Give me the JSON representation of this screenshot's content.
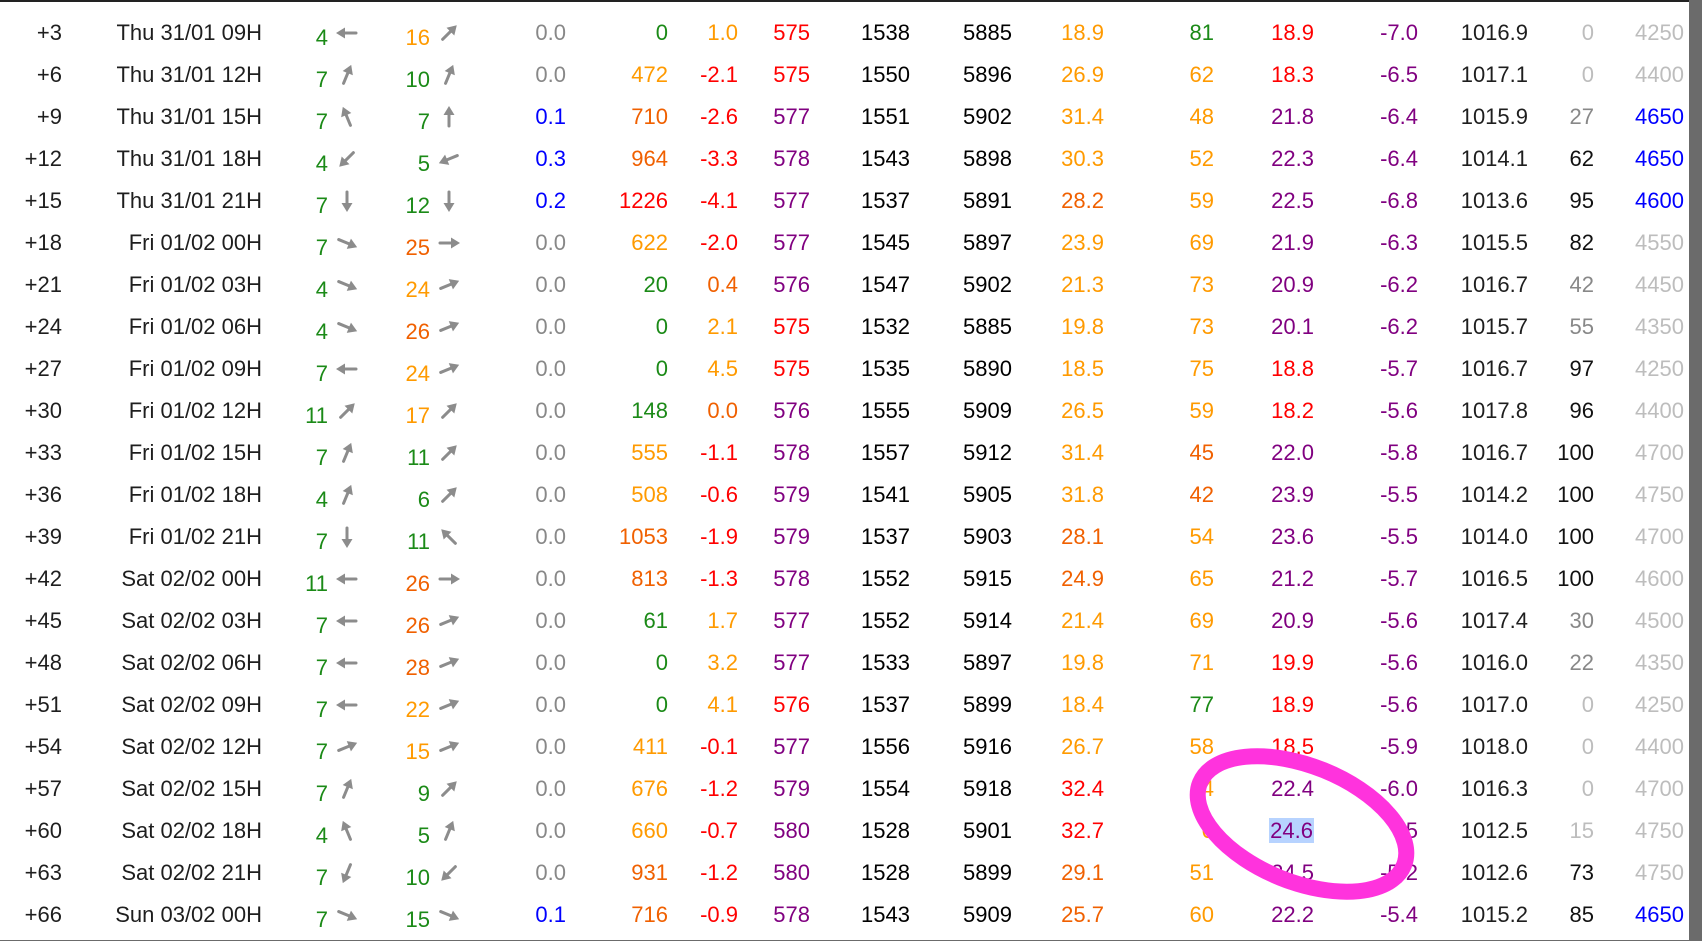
{
  "colors": {
    "green": "#1b8a17",
    "orange": "#ff9a00",
    "dark_orange": "#f06000",
    "red": "#ff0000",
    "purple": "#800080",
    "blue": "#0000ff",
    "gray": "#888888",
    "light_gray": "#bdbdbd",
    "black": "#111111",
    "arrow_gray": "#8c8c8c",
    "marker_magenta": "#ff33dd",
    "selection_blue": "#b7d3ff"
  },
  "annotation": {
    "shape": "ellipse",
    "color": "#ff33dd",
    "highlighted_value": "24.6"
  },
  "rows": [
    {
      "step": "+3",
      "date": "Thu 31/01 09H",
      "w1": "4",
      "w1c": "green",
      "a1": "W",
      "w2": "16",
      "w2c": "orange",
      "a2": "NE",
      "rain": "0.0",
      "rainc": "gray",
      "rad": "0",
      "radc": "green",
      "li": "1.0",
      "lic": "orange",
      "t500": "575",
      "t500c": "red",
      "z850": "1538",
      "z500": "5885",
      "temp": "18.9",
      "tempc": "orange",
      "rh": "81",
      "rhc": "green",
      "dew": "18.9",
      "dewc": "red",
      "t850": "-7.0",
      "t850c": "purple",
      "pres": "1016.9",
      "cloud": "0",
      "cloudc": "light_gray",
      "frz": "4250",
      "frzc": "light_gray"
    },
    {
      "step": "+6",
      "date": "Thu 31/01 12H",
      "w1": "7",
      "w1c": "green",
      "a1": "NNE",
      "w2": "10",
      "w2c": "green",
      "a2": "NNE",
      "rain": "0.0",
      "rainc": "gray",
      "rad": "472",
      "radc": "orange",
      "li": "-2.1",
      "lic": "red",
      "t500": "575",
      "t500c": "red",
      "z850": "1550",
      "z500": "5896",
      "temp": "26.9",
      "tempc": "orange",
      "rh": "62",
      "rhc": "orange",
      "dew": "18.3",
      "dewc": "red",
      "t850": "-6.5",
      "t850c": "purple",
      "pres": "1017.1",
      "cloud": "0",
      "cloudc": "light_gray",
      "frz": "4400",
      "frzc": "light_gray"
    },
    {
      "step": "+9",
      "date": "Thu 31/01 15H",
      "w1": "7",
      "w1c": "green",
      "a1": "NNW",
      "w2": "7",
      "w2c": "green",
      "a2": "N",
      "rain": "0.1",
      "rainc": "blue",
      "rad": "710",
      "radc": "dark_orange",
      "li": "-2.6",
      "lic": "red",
      "t500": "577",
      "t500c": "purple",
      "z850": "1551",
      "z500": "5902",
      "temp": "31.4",
      "tempc": "orange",
      "rh": "48",
      "rhc": "orange",
      "dew": "21.8",
      "dewc": "purple",
      "t850": "-6.4",
      "t850c": "purple",
      "pres": "1015.9",
      "cloud": "27",
      "cloudc": "gray",
      "frz": "4650",
      "frzc": "blue"
    },
    {
      "step": "+12",
      "date": "Thu 31/01 18H",
      "w1": "4",
      "w1c": "green",
      "a1": "SW",
      "w2": "5",
      "w2c": "green",
      "a2": "WSW",
      "rain": "0.3",
      "rainc": "blue",
      "rad": "964",
      "radc": "dark_orange",
      "li": "-3.3",
      "lic": "red",
      "t500": "578",
      "t500c": "purple",
      "z850": "1543",
      "z500": "5898",
      "temp": "30.3",
      "tempc": "orange",
      "rh": "52",
      "rhc": "orange",
      "dew": "22.3",
      "dewc": "purple",
      "t850": "-6.4",
      "t850c": "purple",
      "pres": "1014.1",
      "cloud": "62",
      "cloudc": "black",
      "frz": "4650",
      "frzc": "blue"
    },
    {
      "step": "+15",
      "date": "Thu 31/01 21H",
      "w1": "7",
      "w1c": "green",
      "a1": "S",
      "w2": "12",
      "w2c": "green",
      "a2": "S",
      "rain": "0.2",
      "rainc": "blue",
      "rad": "1226",
      "radc": "red",
      "li": "-4.1",
      "lic": "red",
      "t500": "577",
      "t500c": "purple",
      "z850": "1537",
      "z500": "5891",
      "temp": "28.2",
      "tempc": "dark_orange",
      "rh": "59",
      "rhc": "orange",
      "dew": "22.5",
      "dewc": "purple",
      "t850": "-6.8",
      "t850c": "purple",
      "pres": "1013.6",
      "cloud": "95",
      "cloudc": "black",
      "frz": "4600",
      "frzc": "blue"
    },
    {
      "step": "+18",
      "date": "Fri 01/02 00H",
      "w1": "7",
      "w1c": "green",
      "a1": "ESE",
      "w2": "25",
      "w2c": "dark_orange",
      "a2": "E",
      "rain": "0.0",
      "rainc": "gray",
      "rad": "622",
      "radc": "orange",
      "li": "-2.0",
      "lic": "red",
      "t500": "577",
      "t500c": "purple",
      "z850": "1545",
      "z500": "5897",
      "temp": "23.9",
      "tempc": "orange",
      "rh": "69",
      "rhc": "orange",
      "dew": "21.9",
      "dewc": "purple",
      "t850": "-6.3",
      "t850c": "purple",
      "pres": "1015.5",
      "cloud": "82",
      "cloudc": "black",
      "frz": "4550",
      "frzc": "light_gray"
    },
    {
      "step": "+21",
      "date": "Fri 01/02 03H",
      "w1": "4",
      "w1c": "green",
      "a1": "ESE",
      "w2": "24",
      "w2c": "orange",
      "a2": "ENE",
      "rain": "0.0",
      "rainc": "gray",
      "rad": "20",
      "radc": "green",
      "li": "0.4",
      "lic": "dark_orange",
      "t500": "576",
      "t500c": "purple",
      "z850": "1547",
      "z500": "5902",
      "temp": "21.3",
      "tempc": "orange",
      "rh": "73",
      "rhc": "orange",
      "dew": "20.9",
      "dewc": "purple",
      "t850": "-6.2",
      "t850c": "purple",
      "pres": "1016.7",
      "cloud": "42",
      "cloudc": "gray",
      "frz": "4450",
      "frzc": "light_gray"
    },
    {
      "step": "+24",
      "date": "Fri 01/02 06H",
      "w1": "4",
      "w1c": "green",
      "a1": "ESE",
      "w2": "26",
      "w2c": "dark_orange",
      "a2": "ENE",
      "rain": "0.0",
      "rainc": "gray",
      "rad": "0",
      "radc": "green",
      "li": "2.1",
      "lic": "orange",
      "t500": "575",
      "t500c": "red",
      "z850": "1532",
      "z500": "5885",
      "temp": "19.8",
      "tempc": "orange",
      "rh": "73",
      "rhc": "orange",
      "dew": "20.1",
      "dewc": "purple",
      "t850": "-6.2",
      "t850c": "purple",
      "pres": "1015.7",
      "cloud": "55",
      "cloudc": "gray",
      "frz": "4350",
      "frzc": "light_gray"
    },
    {
      "step": "+27",
      "date": "Fri 01/02 09H",
      "w1": "7",
      "w1c": "green",
      "a1": "W",
      "w2": "24",
      "w2c": "orange",
      "a2": "ENE",
      "rain": "0.0",
      "rainc": "gray",
      "rad": "0",
      "radc": "green",
      "li": "4.5",
      "lic": "orange",
      "t500": "575",
      "t500c": "red",
      "z850": "1535",
      "z500": "5890",
      "temp": "18.5",
      "tempc": "orange",
      "rh": "75",
      "rhc": "orange",
      "dew": "18.8",
      "dewc": "red",
      "t850": "-5.7",
      "t850c": "purple",
      "pres": "1016.7",
      "cloud": "97",
      "cloudc": "black",
      "frz": "4250",
      "frzc": "light_gray"
    },
    {
      "step": "+30",
      "date": "Fri 01/02 12H",
      "w1": "11",
      "w1c": "green",
      "a1": "NE",
      "w2": "17",
      "w2c": "orange",
      "a2": "NE",
      "rain": "0.0",
      "rainc": "gray",
      "rad": "148",
      "radc": "green",
      "li": "0.0",
      "lic": "dark_orange",
      "t500": "576",
      "t500c": "purple",
      "z850": "1555",
      "z500": "5909",
      "temp": "26.5",
      "tempc": "orange",
      "rh": "59",
      "rhc": "orange",
      "dew": "18.2",
      "dewc": "red",
      "t850": "-5.6",
      "t850c": "purple",
      "pres": "1017.8",
      "cloud": "96",
      "cloudc": "black",
      "frz": "4400",
      "frzc": "light_gray"
    },
    {
      "step": "+33",
      "date": "Fri 01/02 15H",
      "w1": "7",
      "w1c": "green",
      "a1": "NNE",
      "w2": "11",
      "w2c": "green",
      "a2": "NE",
      "rain": "0.0",
      "rainc": "gray",
      "rad": "555",
      "radc": "orange",
      "li": "-1.1",
      "lic": "red",
      "t500": "578",
      "t500c": "purple",
      "z850": "1557",
      "z500": "5912",
      "temp": "31.4",
      "tempc": "orange",
      "rh": "45",
      "rhc": "dark_orange",
      "dew": "22.0",
      "dewc": "purple",
      "t850": "-5.8",
      "t850c": "purple",
      "pres": "1016.7",
      "cloud": "100",
      "cloudc": "black",
      "frz": "4700",
      "frzc": "light_gray"
    },
    {
      "step": "+36",
      "date": "Fri 01/02 18H",
      "w1": "4",
      "w1c": "green",
      "a1": "NNE",
      "w2": "6",
      "w2c": "green",
      "a2": "NE",
      "rain": "0.0",
      "rainc": "gray",
      "rad": "508",
      "radc": "orange",
      "li": "-0.6",
      "lic": "red",
      "t500": "579",
      "t500c": "purple",
      "z850": "1541",
      "z500": "5905",
      "temp": "31.8",
      "tempc": "orange",
      "rh": "42",
      "rhc": "dark_orange",
      "dew": "23.9",
      "dewc": "purple",
      "t850": "-5.5",
      "t850c": "purple",
      "pres": "1014.2",
      "cloud": "100",
      "cloudc": "black",
      "frz": "4750",
      "frzc": "light_gray"
    },
    {
      "step": "+39",
      "date": "Fri 01/02 21H",
      "w1": "7",
      "w1c": "green",
      "a1": "S",
      "w2": "11",
      "w2c": "green",
      "a2": "NW",
      "rain": "0.0",
      "rainc": "gray",
      "rad": "1053",
      "radc": "dark_orange",
      "li": "-1.9",
      "lic": "red",
      "t500": "579",
      "t500c": "purple",
      "z850": "1537",
      "z500": "5903",
      "temp": "28.1",
      "tempc": "dark_orange",
      "rh": "54",
      "rhc": "orange",
      "dew": "23.6",
      "dewc": "purple",
      "t850": "-5.5",
      "t850c": "purple",
      "pres": "1014.0",
      "cloud": "100",
      "cloudc": "black",
      "frz": "4700",
      "frzc": "light_gray"
    },
    {
      "step": "+42",
      "date": "Sat 02/02 00H",
      "w1": "11",
      "w1c": "green",
      "a1": "W",
      "w2": "26",
      "w2c": "dark_orange",
      "a2": "E",
      "rain": "0.0",
      "rainc": "gray",
      "rad": "813",
      "radc": "dark_orange",
      "li": "-1.3",
      "lic": "red",
      "t500": "578",
      "t500c": "purple",
      "z850": "1552",
      "z500": "5915",
      "temp": "24.9",
      "tempc": "dark_orange",
      "rh": "65",
      "rhc": "orange",
      "dew": "21.2",
      "dewc": "purple",
      "t850": "-5.7",
      "t850c": "purple",
      "pres": "1016.5",
      "cloud": "100",
      "cloudc": "black",
      "frz": "4600",
      "frzc": "light_gray"
    },
    {
      "step": "+45",
      "date": "Sat 02/02 03H",
      "w1": "7",
      "w1c": "green",
      "a1": "W",
      "w2": "26",
      "w2c": "dark_orange",
      "a2": "ENE",
      "rain": "0.0",
      "rainc": "gray",
      "rad": "61",
      "radc": "green",
      "li": "1.7",
      "lic": "orange",
      "t500": "577",
      "t500c": "purple",
      "z850": "1552",
      "z500": "5914",
      "temp": "21.4",
      "tempc": "orange",
      "rh": "69",
      "rhc": "orange",
      "dew": "20.9",
      "dewc": "purple",
      "t850": "-5.6",
      "t850c": "purple",
      "pres": "1017.4",
      "cloud": "30",
      "cloudc": "gray",
      "frz": "4500",
      "frzc": "light_gray"
    },
    {
      "step": "+48",
      "date": "Sat 02/02 06H",
      "w1": "7",
      "w1c": "green",
      "a1": "W",
      "w2": "28",
      "w2c": "dark_orange",
      "a2": "ENE",
      "rain": "0.0",
      "rainc": "gray",
      "rad": "0",
      "radc": "green",
      "li": "3.2",
      "lic": "orange",
      "t500": "577",
      "t500c": "purple",
      "z850": "1533",
      "z500": "5897",
      "temp": "19.8",
      "tempc": "orange",
      "rh": "71",
      "rhc": "orange",
      "dew": "19.9",
      "dewc": "red",
      "t850": "-5.6",
      "t850c": "purple",
      "pres": "1016.0",
      "cloud": "22",
      "cloudc": "gray",
      "frz": "4350",
      "frzc": "light_gray"
    },
    {
      "step": "+51",
      "date": "Sat 02/02 09H",
      "w1": "7",
      "w1c": "green",
      "a1": "W",
      "w2": "22",
      "w2c": "orange",
      "a2": "ENE",
      "rain": "0.0",
      "rainc": "gray",
      "rad": "0",
      "radc": "green",
      "li": "4.1",
      "lic": "orange",
      "t500": "576",
      "t500c": "red",
      "z850": "1537",
      "z500": "5899",
      "temp": "18.4",
      "tempc": "orange",
      "rh": "77",
      "rhc": "green",
      "dew": "18.9",
      "dewc": "red",
      "t850": "-5.6",
      "t850c": "purple",
      "pres": "1017.0",
      "cloud": "0",
      "cloudc": "light_gray",
      "frz": "4250",
      "frzc": "light_gray"
    },
    {
      "step": "+54",
      "date": "Sat 02/02 12H",
      "w1": "7",
      "w1c": "green",
      "a1": "ENE",
      "w2": "15",
      "w2c": "orange",
      "a2": "ENE",
      "rain": "0.0",
      "rainc": "gray",
      "rad": "411",
      "radc": "orange",
      "li": "-0.1",
      "lic": "red",
      "t500": "577",
      "t500c": "purple",
      "z850": "1556",
      "z500": "5916",
      "temp": "26.7",
      "tempc": "orange",
      "rh": "58",
      "rhc": "orange",
      "dew": "18.5",
      "dewc": "red",
      "t850": "-5.9",
      "t850c": "purple",
      "pres": "1018.0",
      "cloud": "0",
      "cloudc": "light_gray",
      "frz": "4400",
      "frzc": "light_gray"
    },
    {
      "step": "+57",
      "date": "Sat 02/02 15H",
      "w1": "7",
      "w1c": "green",
      "a1": "NNE",
      "w2": "9",
      "w2c": "green",
      "a2": "NE",
      "rain": "0.0",
      "rainc": "gray",
      "rad": "676",
      "radc": "orange",
      "li": "-1.2",
      "lic": "red",
      "t500": "579",
      "t500c": "purple",
      "z850": "1554",
      "z500": "5918",
      "temp": "32.4",
      "tempc": "red",
      "rh": "4",
      "rhc": "orange",
      "dew": "22.4",
      "dewc": "purple",
      "t850": "-6.0",
      "t850c": "purple",
      "pres": "1016.3",
      "cloud": "0",
      "cloudc": "light_gray",
      "frz": "4700",
      "frzc": "light_gray"
    },
    {
      "step": "+60",
      "date": "Sat 02/02 18H",
      "w1": "4",
      "w1c": "green",
      "a1": "NNW",
      "w2": "5",
      "w2c": "green",
      "a2": "NNE",
      "rain": "0.0",
      "rainc": "gray",
      "rad": "660",
      "radc": "orange",
      "li": "-0.7",
      "lic": "red",
      "t500": "580",
      "t500c": "purple",
      "z850": "1528",
      "z500": "5901",
      "temp": "32.7",
      "tempc": "red",
      "rh": "0",
      "rhc": "orange",
      "dew": "24.6",
      "dewc": "purple",
      "t850": "5",
      "t850c": "purple",
      "pres": "1012.5",
      "cloud": "15",
      "cloudc": "light_gray",
      "frz": "4750",
      "frzc": "light_gray",
      "highlight": true
    },
    {
      "step": "+63",
      "date": "Sat 02/02 21H",
      "w1": "7",
      "w1c": "green",
      "a1": "SSW",
      "w2": "10",
      "w2c": "green",
      "a2": "SW",
      "rain": "0.0",
      "rainc": "gray",
      "rad": "931",
      "radc": "dark_orange",
      "li": "-1.2",
      "lic": "red",
      "t500": "580",
      "t500c": "purple",
      "z850": "1528",
      "z500": "5899",
      "temp": "29.1",
      "tempc": "dark_orange",
      "rh": "51",
      "rhc": "orange",
      "dew": "24.5",
      "dewc": "purple",
      "t850": "-5.2",
      "t850c": "purple",
      "pres": "1012.6",
      "cloud": "73",
      "cloudc": "black",
      "frz": "4750",
      "frzc": "light_gray"
    },
    {
      "step": "+66",
      "date": "Sun 03/02 00H",
      "w1": "7",
      "w1c": "green",
      "a1": "ESE",
      "w2": "15",
      "w2c": "green",
      "a2": "ESE",
      "rain": "0.1",
      "rainc": "blue",
      "rad": "716",
      "radc": "dark_orange",
      "li": "-0.9",
      "lic": "red",
      "t500": "578",
      "t500c": "purple",
      "z850": "1543",
      "z500": "5909",
      "temp": "25.7",
      "tempc": "dark_orange",
      "rh": "60",
      "rhc": "orange",
      "dew": "22.2",
      "dewc": "purple",
      "t850": "-5.4",
      "t850c": "purple",
      "pres": "1015.2",
      "cloud": "85",
      "cloudc": "black",
      "frz": "4650",
      "frzc": "blue"
    }
  ]
}
